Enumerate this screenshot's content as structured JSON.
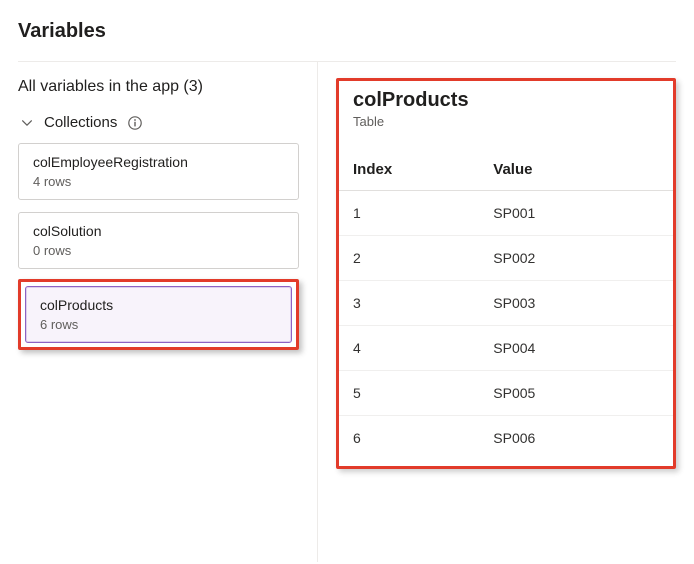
{
  "header": {
    "title": "Variables"
  },
  "sidebar": {
    "subheader": "All variables in the app (3)",
    "section_label": "Collections",
    "items": [
      {
        "title": "colEmployeeRegistration",
        "sub": "4 rows",
        "selected": false
      },
      {
        "title": "colSolution",
        "sub": "0 rows",
        "selected": false
      },
      {
        "title": "colProducts",
        "sub": "6 rows",
        "selected": true
      }
    ]
  },
  "detail": {
    "title": "colProducts",
    "type": "Table",
    "columns": [
      "Index",
      "Value"
    ],
    "rows": [
      {
        "index": "1",
        "value": "SP001"
      },
      {
        "index": "2",
        "value": "SP002"
      },
      {
        "index": "3",
        "value": "SP003"
      },
      {
        "index": "4",
        "value": "SP004"
      },
      {
        "index": "5",
        "value": "SP005"
      },
      {
        "index": "6",
        "value": "SP006"
      }
    ]
  }
}
